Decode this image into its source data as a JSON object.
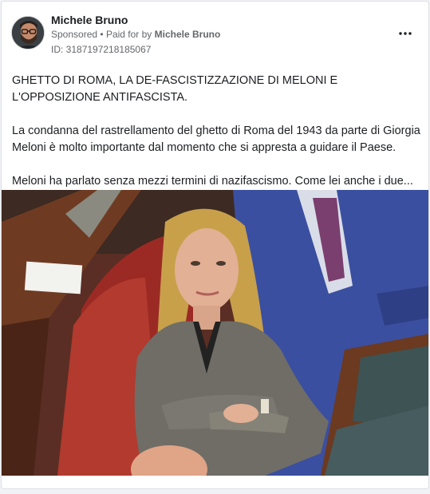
{
  "post": {
    "author": "Michele Bruno",
    "sponsored_label": "Sponsored",
    "separator": "•",
    "paid_for_prefix": "Paid for by",
    "paid_for_name": "Michele Bruno",
    "ad_id": "ID: 3187197218185067",
    "more_icon": "more-horizontal-icon",
    "paragraphs": [
      "GHETTO DI ROMA, LA DE-FASCISTIZZAZIONE DI MELONI E L'OPPOSIZIONE ANTIFASCISTA.",
      "La condanna del rastrellamento del ghetto di Roma del 1943 da parte di Giorgia Meloni è molto importante dal momento che si appresta a guidare il Paese.",
      "Meloni ha parlato senza mezzi termini di nazifascismo. Come lei anche i due..."
    ]
  },
  "colors": {
    "text_primary": "#1c1e21",
    "text_secondary": "#65676b",
    "card_border": "#dddfe2"
  }
}
